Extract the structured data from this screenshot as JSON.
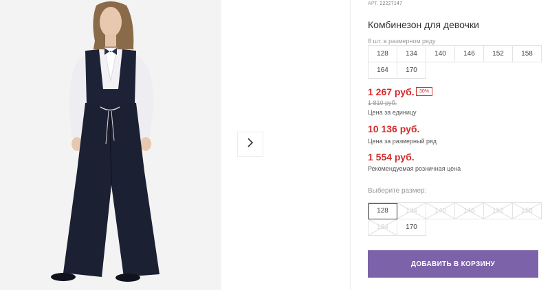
{
  "product": {
    "article_label": "АРТ.",
    "article_number": "22227147",
    "title": "Комбинезон для девочки"
  },
  "pack": {
    "label": "8 шт. в размерном ряду",
    "sizes": [
      "128",
      "134",
      "140",
      "146",
      "152",
      "158",
      "164",
      "170"
    ]
  },
  "prices": {
    "unit_price": "1 267 руб.",
    "discount_badge": "30%",
    "old_price": "1 810 руб.",
    "unit_caption": "Цена за единицу",
    "pack_price": "10 136 руб.",
    "pack_caption": "Цена за размерный ряд",
    "retail_price": "1 554 руб.",
    "retail_caption": "Рекомендуемая розничная цена"
  },
  "size_select": {
    "label": "Выберите размер:",
    "options": [
      {
        "size": "128",
        "state": "selected"
      },
      {
        "size": "134",
        "state": "disabled"
      },
      {
        "size": "140",
        "state": "disabled"
      },
      {
        "size": "146",
        "state": "disabled"
      },
      {
        "size": "152",
        "state": "disabled"
      },
      {
        "size": "158",
        "state": "disabled"
      },
      {
        "size": "164",
        "state": "disabled"
      },
      {
        "size": "170",
        "state": "available"
      }
    ]
  },
  "cart_button_label": "ДОБАВИТЬ В КОРЗИНУ",
  "colors": {
    "accent": "#7c62a8",
    "price_red": "#d42c2c"
  },
  "icons": {
    "gallery_next": "chevron-right-icon"
  }
}
